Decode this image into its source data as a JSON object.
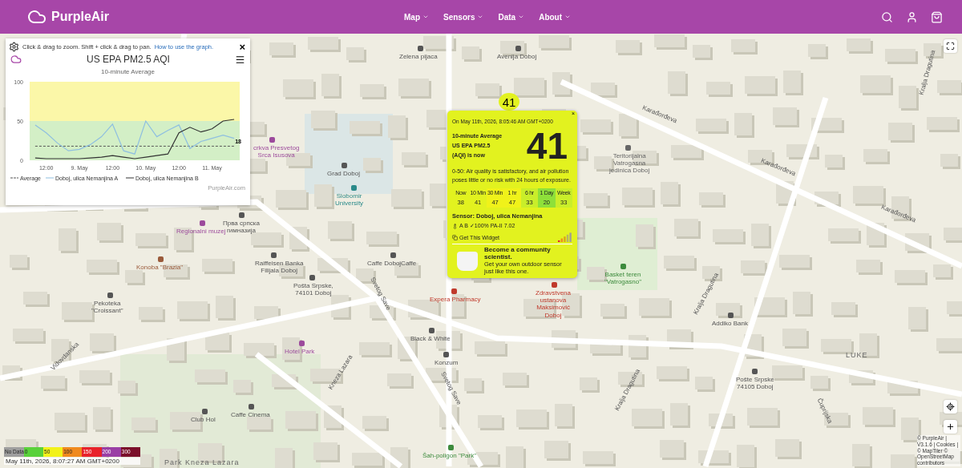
{
  "header": {
    "brand": "PurpleAir",
    "nav": [
      {
        "label": "Map"
      },
      {
        "label": "Sensors"
      },
      {
        "label": "Data"
      },
      {
        "label": "About"
      }
    ]
  },
  "graph_panel": {
    "hint": "Click & drag to zoom. Shift + click & drag to pan.",
    "help_link": "How to use the graph.",
    "close": "×",
    "credit": "PurpleAir.com",
    "chart_data": {
      "type": "line",
      "title": "US EPA PM2.5 AQI",
      "xlabel": "10-minute Average",
      "categories": [
        null,
        "12:00",
        null,
        null,
        "9. May",
        null,
        null,
        "12:00",
        null,
        null,
        "10. May",
        null,
        null,
        "12:00",
        null,
        null,
        "11. May",
        null,
        null
      ],
      "ylim": [
        0,
        100
      ],
      "yticks": [
        0,
        50,
        100
      ],
      "series": [
        {
          "name": "Average",
          "color": "#555555",
          "line_style": "dashed",
          "values": [
            18,
            18,
            18,
            18,
            18,
            18,
            18,
            18,
            18,
            18,
            18,
            18,
            18,
            18,
            18,
            18,
            18,
            18,
            18
          ]
        },
        {
          "name": "Doboj, ulica Nemanjina A",
          "color": "#8fbfe0",
          "line_style": "solid",
          "values": [
            45,
            35,
            22,
            12,
            14,
            20,
            30,
            46,
            12,
            8,
            50,
            30,
            38,
            45,
            15,
            24,
            28,
            32,
            28
          ]
        },
        {
          "name": "Doboj, ulica Nemanjina B",
          "color": "#333333",
          "line_style": "solid",
          "values": [
            3,
            2,
            2,
            2,
            2,
            3,
            4,
            6,
            4,
            2,
            4,
            6,
            8,
            35,
            42,
            36,
            40,
            50,
            52
          ]
        }
      ],
      "legend": true,
      "annotations": [
        {
          "y": 18,
          "text": "18"
        }
      ]
    }
  },
  "map_labels": [
    {
      "text": "Zelena pijaca",
      "kind": "poi",
      "color": "#555555"
    },
    {
      "text": "Avenija Doboj",
      "kind": "poi",
      "color": "#555555"
    },
    {
      "text": "Karađorđeva",
      "kind": "street"
    },
    {
      "text": "Karađorđeva",
      "kind": "street"
    },
    {
      "text": "Karađorđeva",
      "kind": "street"
    },
    {
      "text": "Kralja Dragutina",
      "kind": "street"
    },
    {
      "text": "Teritorijalna Vatrogasna jedinica Doboj",
      "kind": "poi",
      "color": "#666666"
    },
    {
      "text": "crkva Presvetog Srca Isusova",
      "kind": "poi",
      "color": "#9c4a9c"
    },
    {
      "text": "Grad Doboj",
      "kind": "poi",
      "color": "#555555"
    },
    {
      "text": "Slobomir University",
      "kind": "poi",
      "color": "#2a8a8a"
    },
    {
      "text": "Прва српска гимназија",
      "kind": "poi",
      "color": "#555555"
    },
    {
      "text": "Regionalni muzej",
      "kind": "poi",
      "color": "#9c4a9c"
    },
    {
      "text": "Konoba \"Brazia\"",
      "kind": "poi",
      "color": "#9a5a3a"
    },
    {
      "text": "Raiffeisen Banka Filijala Doboj",
      "kind": "poi",
      "color": "#555555"
    },
    {
      "text": "Caffe DobojCaffe",
      "kind": "poi",
      "color": "#555555"
    },
    {
      "text": "Pošta Srpske, 74101 Doboj",
      "kind": "poi",
      "color": "#555555"
    },
    {
      "text": "Pekoteka \"Croissant\"",
      "kind": "poi",
      "color": "#555555"
    },
    {
      "text": "Svetog Save",
      "kind": "street"
    },
    {
      "text": "Expera Pharmacy",
      "kind": "poi",
      "color": "#c0392b"
    },
    {
      "text": "Zdravstvena ustanova Maksimović Doboj",
      "kind": "poi",
      "color": "#c0392b"
    },
    {
      "text": "Basket teren \"Vatrogasno\"",
      "kind": "poi",
      "color": "#3c8a3c"
    },
    {
      "text": "Kralja Dragutina",
      "kind": "street"
    },
    {
      "text": "Addiko Bank",
      "kind": "poi",
      "color": "#555555"
    },
    {
      "text": "Kralja Dragutina",
      "kind": "street"
    },
    {
      "text": "Hotel Park",
      "kind": "poi",
      "color": "#9c4a9c"
    },
    {
      "text": "Black & White",
      "kind": "poi",
      "color": "#555555"
    },
    {
      "text": "Konzum",
      "kind": "poi",
      "color": "#555555"
    },
    {
      "text": "Kneza Lazara",
      "kind": "street"
    },
    {
      "text": "Vidovdanska",
      "kind": "street"
    },
    {
      "text": "LUKE",
      "kind": "area"
    },
    {
      "text": "Pošte Srpske 74105 Doboj",
      "kind": "poi",
      "color": "#555555"
    },
    {
      "text": "Čuprijska",
      "kind": "street"
    },
    {
      "text": "Club Hol",
      "kind": "poi",
      "color": "#555555"
    },
    {
      "text": "Caffe Cinema",
      "kind": "poi",
      "color": "#555555"
    },
    {
      "text": "Svetog Save",
      "kind": "street"
    },
    {
      "text": "Šah-poligon \"Park\"",
      "kind": "poi",
      "color": "#3c8a3c"
    },
    {
      "text": "Park Kneza Lazara",
      "kind": "area"
    }
  ],
  "marker": {
    "value": "41"
  },
  "popup": {
    "close": "×",
    "timestamp": "On May 11th, 2026, 8:05:46 AM GMT+0200",
    "heading": [
      "10-minute Average",
      "US EPA PM2.5",
      "(AQI) is now"
    ],
    "value": "41",
    "description": "0-50: Air quality is satisfactory, and air pollution poses little or no risk with 24 hours of exposure.",
    "averages": [
      {
        "label": "Now",
        "value": "38",
        "color": "#e2f21f"
      },
      {
        "label": "10 Min",
        "value": "41",
        "color": "#e2f21f"
      },
      {
        "label": "30 Min",
        "value": "47",
        "color": "#f0f21a"
      },
      {
        "label": "1 hr",
        "value": "47",
        "color": "#f0f21a"
      },
      {
        "label": "6 hr",
        "value": "33",
        "color": "#c9ee2a"
      },
      {
        "label": "1 Day",
        "value": "20",
        "color": "#8ee03a"
      },
      {
        "label": "Week",
        "value": "33",
        "color": "#c9ee2a"
      }
    ],
    "sensor": "Sensor: Doboj, ulica Nemanjina",
    "status": "A B ✓100% PA-II 7.02",
    "widget_link": "Get This Widget",
    "promo_title": "Become a community scientist.",
    "promo_text": "Get your own outdoor sensor just like this one."
  },
  "legend": {
    "scale": [
      {
        "label": "No Data",
        "color": "#9e9e9e"
      },
      {
        "label": "0",
        "color": "#59d13a"
      },
      {
        "label": "50",
        "color": "#f2f21a"
      },
      {
        "label": "100",
        "color": "#f08a1e"
      },
      {
        "label": "150",
        "color": "#e8222a"
      },
      {
        "label": "200",
        "color": "#9a3fa5"
      },
      {
        "label": "300",
        "color": "#7a0f2a"
      }
    ],
    "timestamp": "May 11th, 2026, 8:07:27 AM GMT+0200"
  },
  "attribution": "© PurpleAir | V3.1.6 | Cookies | © MapTiler © OpenStreetMap contributors"
}
